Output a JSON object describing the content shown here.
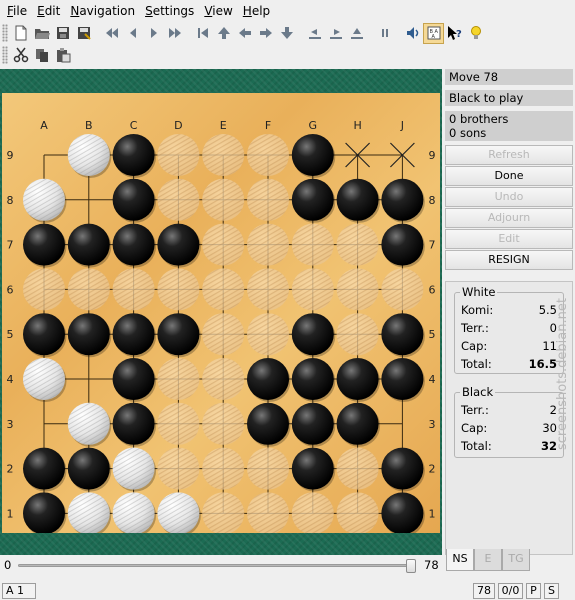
{
  "menubar": {
    "items": [
      {
        "label": "File",
        "key": "F",
        "rest": "ile"
      },
      {
        "label": "Edit",
        "key": "E",
        "rest": "dit"
      },
      {
        "label": "Navigation",
        "key": "N",
        "rest": "avigation"
      },
      {
        "label": "Settings",
        "key": "S",
        "rest": "ettings"
      },
      {
        "label": "View",
        "key": "V",
        "rest": "iew"
      },
      {
        "label": "Help",
        "key": "H",
        "rest": "elp"
      }
    ]
  },
  "toolbar": {
    "row1_icons": [
      "new-file-icon",
      "open-folder-icon",
      "save-icon",
      "save-as-icon",
      "first-move-icon",
      "previous-move-icon",
      "next-move-icon",
      "last-move-icon",
      "previous-variation-icon",
      "up-icon",
      "previous-branch-icon",
      "next-branch-icon",
      "down-icon",
      "variation-left-icon",
      "variation-right-icon",
      "variation-alt-icon",
      "pause-icon",
      "sound-icon",
      "coordinates-icon",
      "whats-this-icon",
      "hint-bulb-icon"
    ],
    "row2_icons": [
      "cut-icon",
      "copy-icon",
      "paste-icon"
    ]
  },
  "board": {
    "columns": [
      "A",
      "B",
      "C",
      "D",
      "E",
      "F",
      "G",
      "H",
      "J"
    ],
    "rows": [
      "9",
      "8",
      "7",
      "6",
      "5",
      "4",
      "3",
      "2",
      "1"
    ],
    "black": [
      "C9",
      "G9",
      "C8",
      "G8",
      "H8",
      "J8",
      "A7",
      "B7",
      "C7",
      "D7",
      "J7",
      "A5",
      "B5",
      "C5",
      "D5",
      "G5",
      "J5",
      "C4",
      "F4",
      "G4",
      "H4",
      "J4",
      "C3",
      "F3",
      "G3",
      "H3",
      "A2",
      "B2",
      "G2",
      "J2",
      "A1",
      "J1"
    ],
    "white": [
      "B9",
      "A8",
      "A4",
      "B3",
      "C2",
      "B1",
      "C1",
      "D1"
    ],
    "black_territory": [
      "D9",
      "E9",
      "F9",
      "D8",
      "E8",
      "F8",
      "E7",
      "F7",
      "G7",
      "H7",
      "A6",
      "B6",
      "C6",
      "D6",
      "E6",
      "F6",
      "G6",
      "H6",
      "J6",
      "E5",
      "F5",
      "H5",
      "D4",
      "E4",
      "D3",
      "E3",
      "D2",
      "E2",
      "F2",
      "H2",
      "E1",
      "F1",
      "G1",
      "H1"
    ],
    "white_territory": [],
    "dead_marks": [
      "H9",
      "J9"
    ]
  },
  "panel": {
    "move": "Move 78",
    "to_play": "Black to play",
    "brothers": "0 brothers",
    "sons": "0 sons",
    "buttons": {
      "refresh": "Refresh",
      "done": "Done",
      "undo": "Undo",
      "adjourn": "Adjourn",
      "edit": "Edit",
      "resign": "RESIGN"
    },
    "white": {
      "title": "White",
      "komi_label": "Komi:",
      "komi": "5.5",
      "terr_label": "Terr.:",
      "terr": "0",
      "cap_label": "Cap:",
      "cap": "11",
      "total_label": "Total:",
      "total": "16.5"
    },
    "black": {
      "title": "Black",
      "terr_label": "Terr.:",
      "terr": "2",
      "cap_label": "Cap:",
      "cap": "30",
      "total_label": "Total:",
      "total": "32"
    },
    "tabs": [
      "NS",
      "E",
      "TG"
    ]
  },
  "slider": {
    "min": "0",
    "max": "78",
    "value": 78
  },
  "statusbar": {
    "position": "A 1",
    "move": "78",
    "captures": "0/0",
    "p": "P",
    "s": "S"
  },
  "watermark": "screenshots.debian.net"
}
